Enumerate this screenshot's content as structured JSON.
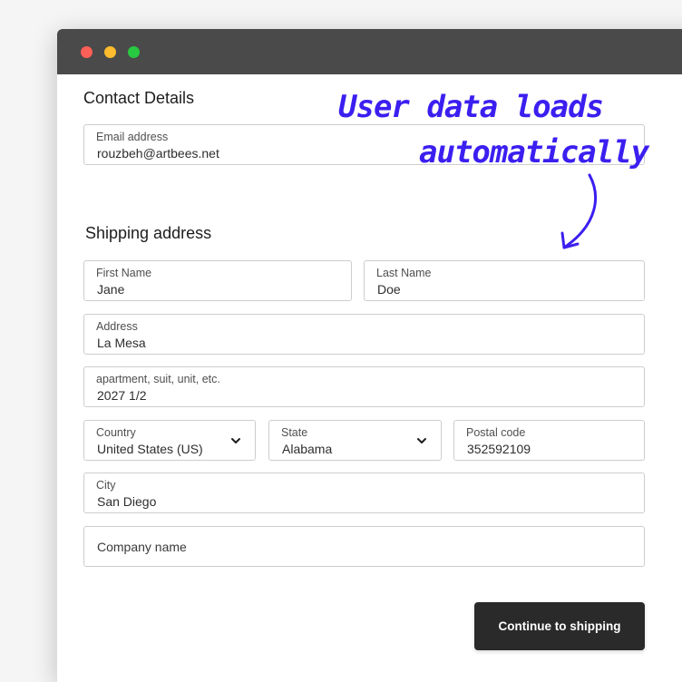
{
  "window": {
    "controls": [
      "close",
      "minimize",
      "maximize"
    ]
  },
  "contact": {
    "title": "Contact Details",
    "email": {
      "label": "Email address",
      "value": "rouzbeh@artbees.net"
    }
  },
  "shipping": {
    "title": "Shipping address",
    "first_name": {
      "label": "First Name",
      "value": "Jane"
    },
    "last_name": {
      "label": "Last Name",
      "value": "Doe"
    },
    "address": {
      "label": "Address",
      "value": "La Mesa"
    },
    "apartment": {
      "label": "apartment, suit, unit, etc.",
      "value": "2027 1/2"
    },
    "country": {
      "label": "Country",
      "value": "United States (US)",
      "icon": "chevron-down-icon"
    },
    "state": {
      "label": "State",
      "value": "Alabama",
      "icon": "chevron-down-icon"
    },
    "postal_code": {
      "label": "Postal code",
      "value": "352592109"
    },
    "city": {
      "label": "City",
      "value": "San Diego"
    },
    "company": {
      "placeholder": "Company name"
    }
  },
  "actions": {
    "continue_label": "Continue to shipping"
  },
  "annotation": {
    "line1": "User data loads",
    "line2": "automatically",
    "color": "#3b1ff0",
    "icon": "curved-arrow-icon"
  }
}
